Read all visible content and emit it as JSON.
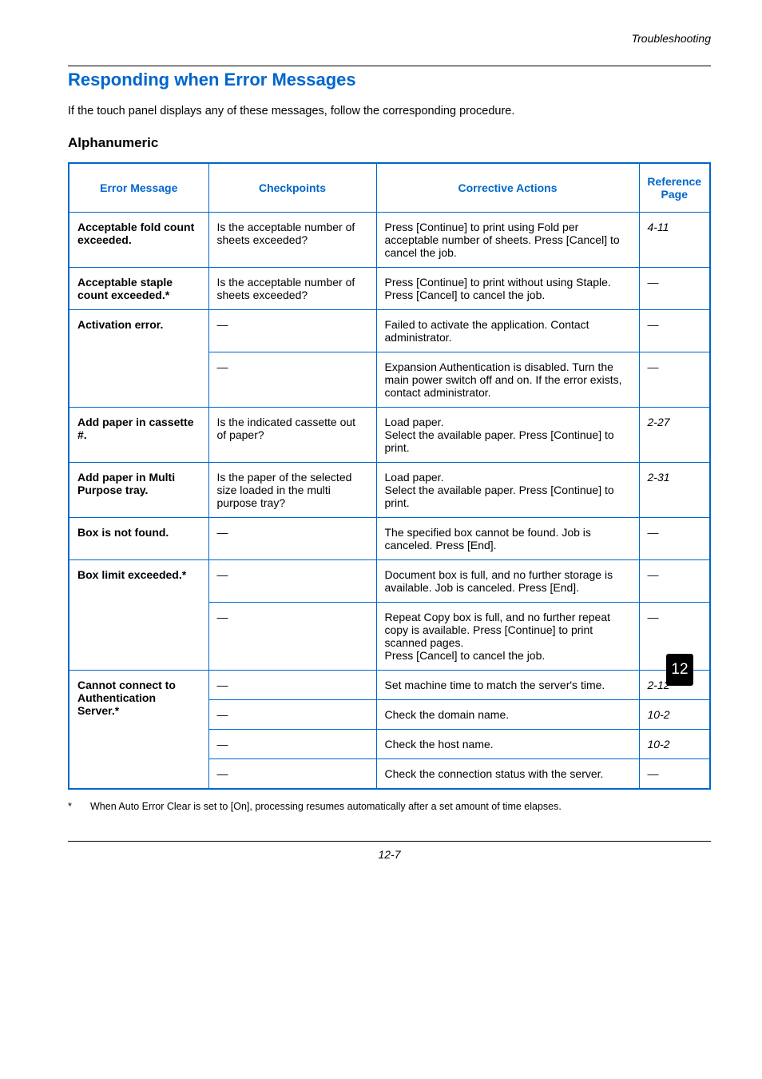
{
  "header": {
    "category": "Troubleshooting"
  },
  "title": "Responding when Error Messages",
  "intro": "If the touch panel displays any of these messages, follow the corresponding procedure.",
  "subtitle": "Alphanumeric",
  "columns": {
    "c1": "Error Message",
    "c2": "Checkpoints",
    "c3": "Corrective Actions",
    "c4": "Reference Page"
  },
  "rows": [
    {
      "msg": "Acceptable fold count exceeded.",
      "msgrows": 1,
      "chk": "Is the acceptable number of sheets exceeded?",
      "act": "Press [Continue] to print using Fold per acceptable number of sheets. Press [Cancel] to cancel the job.",
      "ref": "4-11"
    },
    {
      "msg": "Acceptable staple count exceeded.*",
      "msgrows": 1,
      "chk": "Is the acceptable number of sheets exceeded?",
      "act": "Press [Continue] to print without using Staple. Press [Cancel] to cancel the job.",
      "ref": "—"
    },
    {
      "msg": "Activation error.",
      "msgrows": 2,
      "chk": "—",
      "act": "Failed to activate the application. Contact administrator.",
      "ref": "—"
    },
    {
      "chk": "—",
      "act": "Expansion Authentication is disabled. Turn the main power switch off and on. If the error exists, contact administrator.",
      "ref": "—"
    },
    {
      "msg": "Add paper in cassette #.",
      "msgrows": 1,
      "chk": "Is the indicated cassette out of paper?",
      "act": "Load paper.\nSelect the available paper. Press [Continue] to print.",
      "ref": "2-27"
    },
    {
      "msg": "Add paper in Multi Purpose tray.",
      "msgrows": 1,
      "chk": "Is the paper of the selected size loaded in the multi purpose tray?",
      "act": "Load paper.\nSelect the available paper. Press [Continue] to print.",
      "ref": "2-31"
    },
    {
      "msg": "Box is not found.",
      "msgrows": 1,
      "chk": "—",
      "act": "The specified box cannot be found. Job is canceled. Press [End].",
      "ref": "—"
    },
    {
      "msg": "Box limit exceeded.*",
      "msgrows": 2,
      "chk": "—",
      "act": "Document box is full, and no further storage is available. Job is canceled. Press [End].",
      "ref": "—"
    },
    {
      "chk": "—",
      "act": "Repeat Copy box is full, and no further repeat copy is available. Press [Continue] to print scanned pages.\nPress [Cancel] to cancel the job.",
      "ref": "—"
    },
    {
      "msg": "Cannot connect to Authentication Server.*",
      "msgrows": 4,
      "chk": "—",
      "act": "Set machine time to match the server's time.",
      "ref": "2-12"
    },
    {
      "chk": "—",
      "act": "Check the domain name.",
      "ref": "10-2"
    },
    {
      "chk": "—",
      "act": "Check the host name.",
      "ref": "10-2"
    },
    {
      "chk": "—",
      "act": "Check the connection status with the server.",
      "ref": "—"
    }
  ],
  "footnote": "When Auto Error Clear is set to [On], processing resumes automatically after a set amount of time elapses.",
  "footnote_marker": "*",
  "page_number": "12-7",
  "side_tab": "12"
}
